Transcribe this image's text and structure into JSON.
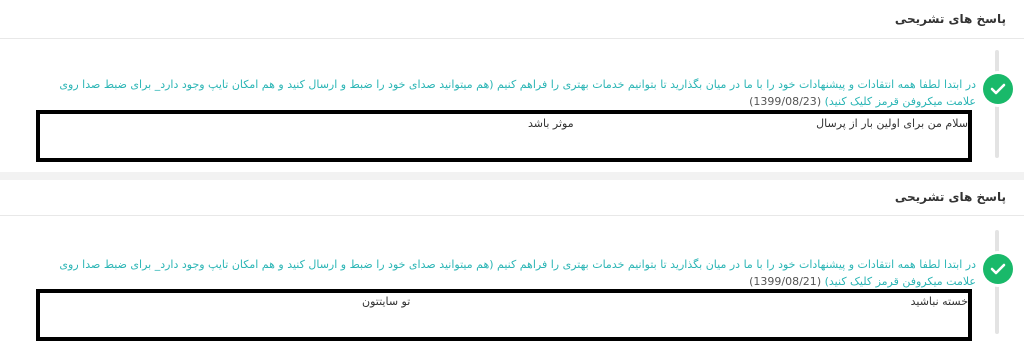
{
  "cards": [
    {
      "section_title": "پاسخ های تشریحی",
      "question_text": "در ابتدا لطفا همه انتقادات و پیشنهادات خود را با ما در میان بگذارید تا بتوانیم خدمات بهتری را فراهم کنیم (هم میتوانید صدای خود را ضبط و ارسال کنید و هم امکان تایپ وجود دارد_ برای ضبط صدا روی علامت میکروفن قرمز کلیک کنید)",
      "date": "(1399/08/23)",
      "answer_line_right": "سلام من برای اولین بار از پرسال",
      "answer_line_left": "موثر باشد",
      "status_icon": "check-icon"
    },
    {
      "section_title": "پاسخ های تشریحی",
      "question_text": "در ابتدا لطفا همه انتقادات و پیشنهادات خود را با ما در میان بگذارید تا بتوانیم خدمات بهتری را فراهم کنیم (هم میتوانید صدای خود را ضبط و ارسال کنید و هم امکان تایپ وجود دارد_ برای ضبط صدا روی علامت میکروفن قرمز کلیک کنید)",
      "date": "(1399/08/21)",
      "answer_line_right": "خسته نباشید",
      "answer_line_left": "تو سایتتون",
      "status_icon": "check-icon"
    }
  ],
  "colors": {
    "accent": "#19b96a",
    "question": "#2bb5b5"
  }
}
